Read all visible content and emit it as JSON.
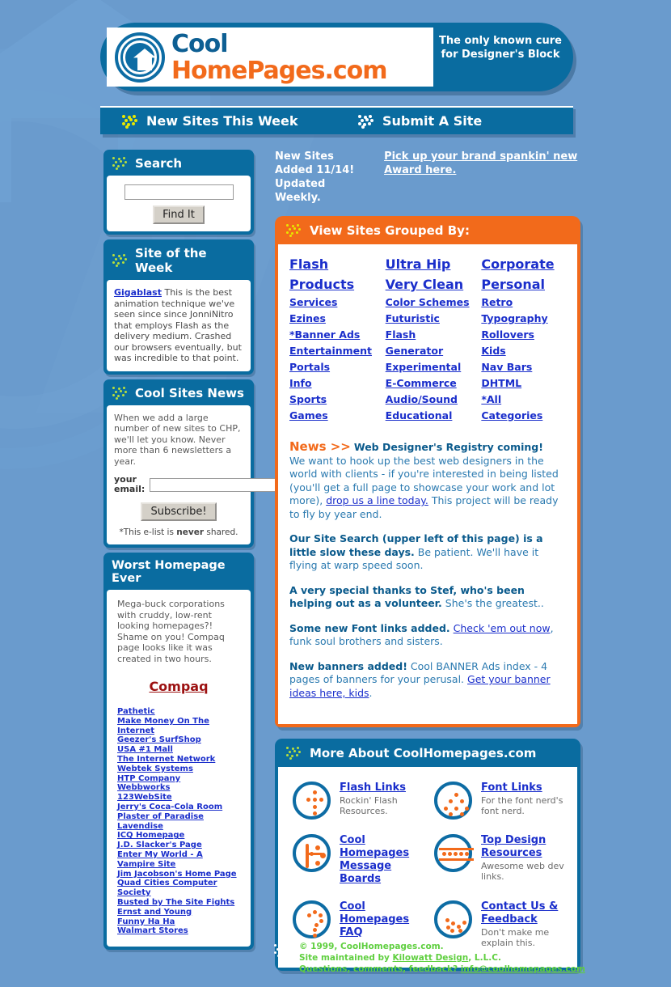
{
  "header": {
    "logo_line1": "Cool",
    "logo_home": "Home",
    "logo_pages": "Pages",
    "logo_com": ".com",
    "tagline": "The only known cure for Designer's Block"
  },
  "nav": {
    "new_sites": "New Sites This Week",
    "submit_site": "Submit A Site"
  },
  "sidebar": {
    "search": {
      "title": "Search",
      "input_value": "",
      "placeholder": "",
      "button": "Find It"
    },
    "site_of_week": {
      "title": "Site of the Week",
      "link": "Gigablast",
      "text": " This is the best animation technique we've seen since since JonniNitro that employs Flash as the delivery medium. Crashed our browsers eventually, but was incredible to that point."
    },
    "news": {
      "title": "Cool Sites News",
      "text": "When we add a large number of new sites to CHP, we'll let you know. Never more than 6 newsletters a year.",
      "email_label": "your email:",
      "email_value": "",
      "subscribe": "Subscribe!",
      "note_pre": "*This e-list is ",
      "note_bold": "never",
      "note_post": " shared."
    },
    "worst": {
      "title": "Worst Homepage Ever",
      "text": "Mega-buck corporations with cruddy, low-rent looking homepages?! Shame on you! Compaq page looks like it was created in two hours.",
      "featured": "Compaq",
      "links": [
        "Pathetic",
        "Make Money On The Internet",
        "Geezer's SurfShop",
        "USA #1 Mall",
        "The Internet Network",
        "Webtek Systems",
        "HTP Company",
        "Webbworks",
        "123WebSite",
        "Jerry's Coca-Cola Room",
        "Plaster of Paradise",
        "Lavendise",
        "ICQ Homepage",
        "J.D. Slacker's Page",
        "Enter My World - A Vampire Site",
        "Jim Jacobson's Home Page",
        "Quad Cities Computer Society",
        "Busted by The Site Fights",
        "Ernst and Young",
        "Funny Ha Ha",
        "Walmart Stores"
      ]
    }
  },
  "main": {
    "new_sites_added": "New Sites Added 11/14! Updated Weekly.",
    "award_link": "Pick up your brand spankin' new Award here.",
    "grouped": {
      "title": "View Sites Grouped By:",
      "col1": [
        "Flash",
        "Products",
        "Services",
        "Ezines",
        "*Banner Ads",
        "Entertainment",
        "Portals",
        "Info",
        "Sports",
        "Games"
      ],
      "col2": [
        "Ultra Hip",
        "Very Clean",
        "Color Schemes",
        "Futuristic",
        "Flash Generator",
        "Experimental",
        "E-Commerce",
        "Audio/Sound",
        "Educational"
      ],
      "col3": [
        "Corporate",
        "Personal",
        "Retro",
        "Typography",
        "Rollovers",
        "Kids",
        "Nav Bars",
        "DHTML",
        "*All Categories"
      ]
    },
    "news": {
      "kw": "News >>",
      "headline1": "Web Designer's Registry coming!",
      "body1a": "We want to hook up the best web designers in the world with clients - if you're interested in being listed (you'll get a full page to showcase your work and lot more), ",
      "link1": "drop us a line today.",
      "body1b": " This project will be ready to fly by year end.",
      "headline2": "Our Site Search (upper left of this page) is a little slow these days.",
      "body2": " Be patient. We'll have it flying at warp speed soon.",
      "headline3": "A very special thanks to Stef, who's been helping out as a volunteer.",
      "body3": " She's the greatest..",
      "headline4": "Some new Font links added.",
      "link4": "Check 'em out now",
      "body4": ", funk soul brothers and sisters.",
      "headline5": "New banners added!",
      "body5": " Cool BANNER Ads index - 4 pages of banners for your perusal. ",
      "link5": "Get your banner ideas here, kids",
      "body5b": "."
    },
    "about": {
      "title": "More About CoolHomepages.com",
      "items": [
        {
          "link": "Flash Links",
          "desc": "Rockin' Flash Resources.",
          "icon": "flash-dots-icon"
        },
        {
          "link": "Font Links",
          "desc": "For the font nerd's font nerd.",
          "icon": "font-dots-icon"
        },
        {
          "link": "Cool Homepages Message Boards",
          "desc": "",
          "icon": "message-boards-icon"
        },
        {
          "link": "Top Design Resources",
          "desc": "Awesome web dev links.",
          "icon": "top-design-icon"
        },
        {
          "link": "Cool Homepages FAQ",
          "desc": "",
          "icon": "faq-icon"
        },
        {
          "link": "Contact Us & Feedback",
          "desc": "Don't make me explain this.",
          "icon": "contact-icon"
        }
      ]
    }
  },
  "footer": {
    "copyright": "© 1999, CoolHomepages.com.",
    "maintained_pre": "Site maintained by ",
    "maintained_link": "Kilowatt Design",
    "maintained_post": ", L.L.C.",
    "questions_pre": "Questions, comments, feedback? ",
    "email": "info@coolhomepages.com"
  },
  "colors": {
    "background": "#6a9bcd",
    "panel_blue": "#0a6ca0",
    "accent_orange": "#f26a1b",
    "link_blue": "#1a2ecb",
    "footer_green": "#5fcf3f",
    "dot_yellow": "#e8e800",
    "compaq_red": "#9c1111"
  }
}
